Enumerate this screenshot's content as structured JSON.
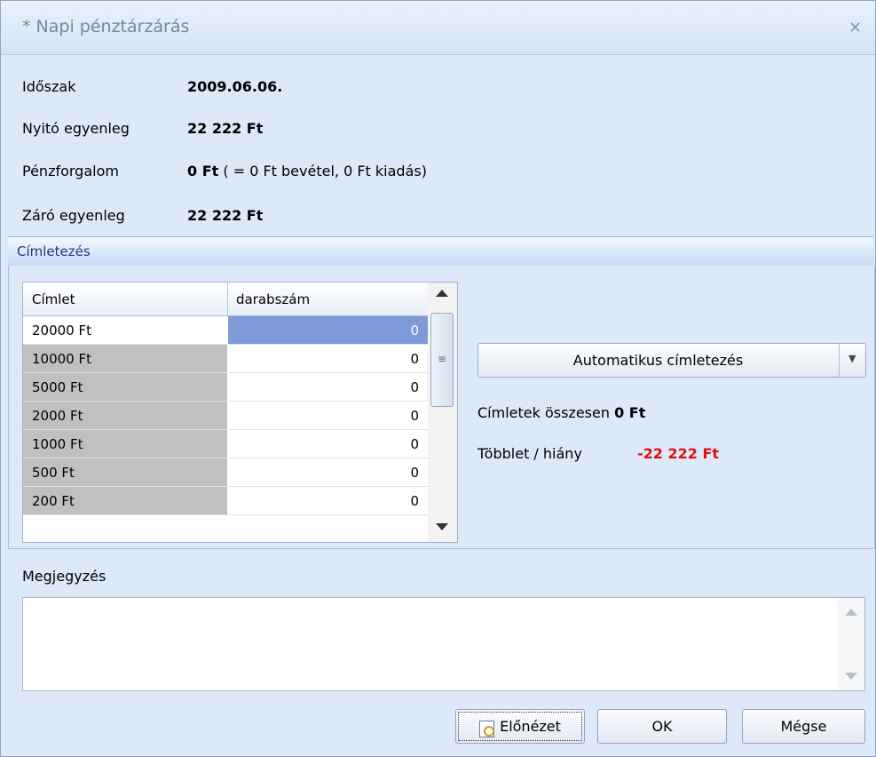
{
  "window": {
    "title": "* Napi pénztárzárás",
    "close_icon": "close-icon"
  },
  "summary": {
    "period_label": "Időszak",
    "period_value": "2009.06.06.",
    "opening_label": "Nyitó egyenleg",
    "opening_value": "22 222 Ft",
    "flow_label": "Pénzforgalom",
    "flow_value": "0 Ft",
    "flow_detail": " ( = 0 Ft bevétel, 0 Ft kiadás)",
    "closing_label": "Záró egyenleg",
    "closing_value": "22 222 Ft"
  },
  "denominations": {
    "group_title": "Címletezés",
    "columns": [
      "Címlet",
      "darabszám"
    ],
    "rows": [
      {
        "name": "20000 Ft",
        "count": "0"
      },
      {
        "name": "10000 Ft",
        "count": "0"
      },
      {
        "name": "5000 Ft",
        "count": "0"
      },
      {
        "name": "2000 Ft",
        "count": "0"
      },
      {
        "name": "1000 Ft",
        "count": "0"
      },
      {
        "name": "500 Ft",
        "count": "0"
      },
      {
        "name": "200 Ft",
        "count": "0"
      }
    ],
    "auto_button": "Automatikus címletezés",
    "total_label": "Címletek összesen",
    "total_value": "0 Ft",
    "diff_label": "Többlet / hiány",
    "diff_value": "-22 222 Ft"
  },
  "note": {
    "label": "Megjegyzés",
    "value": ""
  },
  "buttons": {
    "preview": "Előnézet",
    "ok": "OK",
    "cancel": "Mégse"
  },
  "colors": {
    "accent": "#7f9ad8",
    "negative": "#e01010",
    "row_shaded": "#c0c0c0"
  }
}
